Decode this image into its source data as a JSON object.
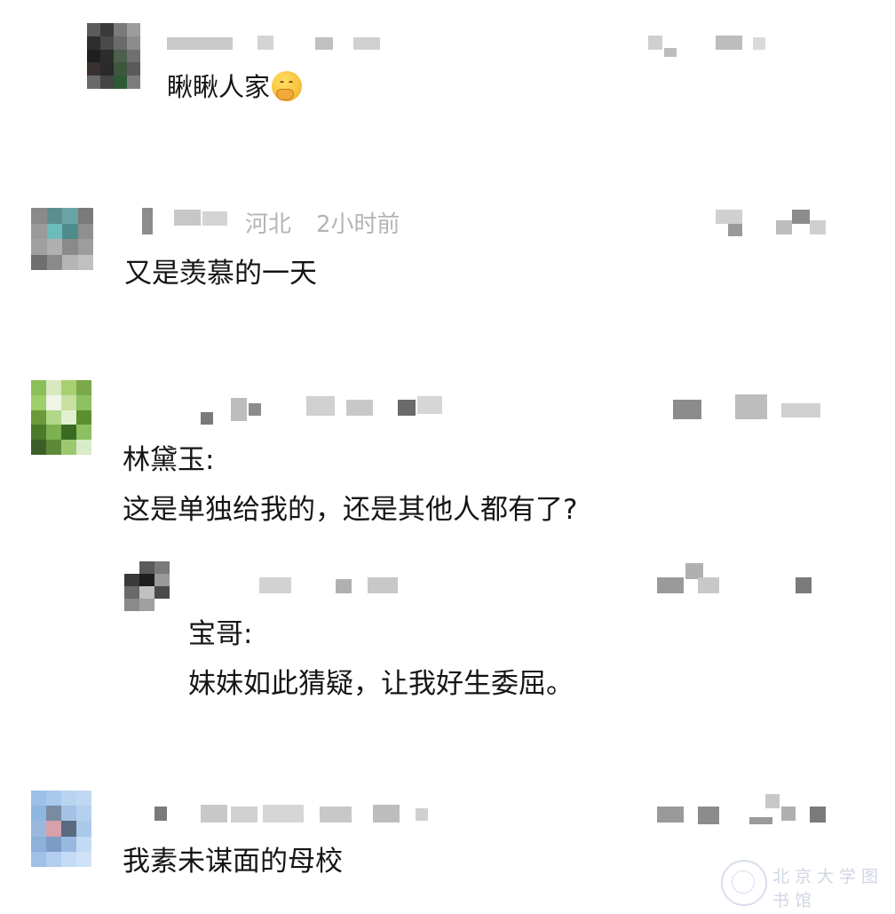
{
  "comments": [
    {
      "text": "瞅瞅人家",
      "emoji": "face-with-hand-over-mouth-emoji"
    },
    {
      "meta_location": "河北",
      "meta_time": "2小时前",
      "text": "又是羡慕的一天"
    },
    {
      "speaker": "林黛玉:",
      "text": "这是单独给我的，还是其他人都有了?",
      "reply": {
        "speaker": "宝哥:",
        "text": "妹妹如此猜疑，让我好生委屈。"
      }
    },
    {
      "text": "我素未谋面的母校"
    }
  ],
  "watermark": {
    "text": "北京大学图书馆",
    "logo_icon": "university-seal-icon"
  },
  "colors": {
    "background": "#ffffff",
    "text": "#151515",
    "meta": "#b4b4b4",
    "pixelation": "#8c8c8c"
  }
}
